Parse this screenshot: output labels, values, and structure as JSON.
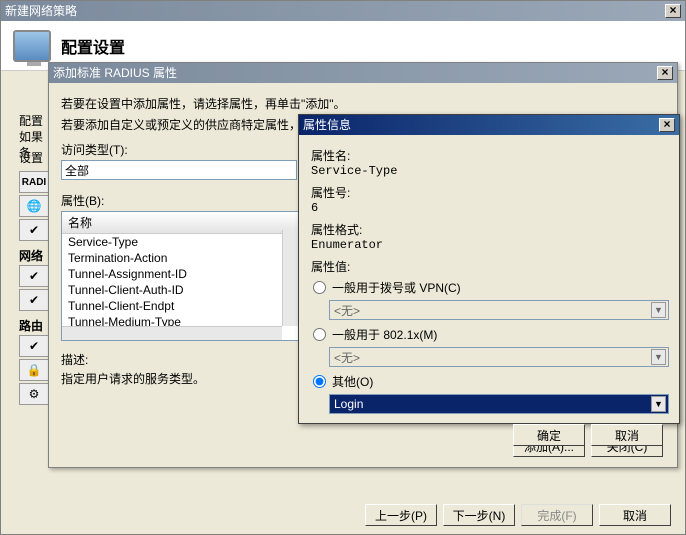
{
  "main": {
    "title": "新建网络策略",
    "header": "配置设置",
    "desc1": "配置",
    "desc2": "如果条",
    "settingsLabel": "设置",
    "radiLabel": "RADI",
    "sectionNet": "网络",
    "sectionRoute": "路由",
    "btnPrev": "上一步(P)",
    "btnNext": "下一步(N)",
    "btnFinish": "完成(F)",
    "btnCancel": "取消"
  },
  "radiusDlg": {
    "title": "添加标准 RADIUS 属性",
    "instr1": "若要在设置中添加属性，请选择属性，再单击\"添加\"。",
    "instr2": "若要添加自定义或预定义的供应商特定属性，",
    "accessLabel": "访问类型(T):",
    "accessValue": "全部",
    "attrLabel": "属性(B):",
    "listHeader": "名称",
    "items": [
      "Service-Type",
      "Termination-Action",
      "Tunnel-Assignment-ID",
      "Tunnel-Client-Auth-ID",
      "Tunnel-Client-Endpt",
      "Tunnel-Medium-Type"
    ],
    "descLabel": "描述:",
    "descText": "指定用户请求的服务类型。",
    "btnAdd": "添加(A)...",
    "btnClose": "关闭(C)"
  },
  "attrDlg": {
    "title": "属性信息",
    "nameLabel": "属性名:",
    "nameValue": "Service-Type",
    "numLabel": "属性号:",
    "numValue": "6",
    "formatLabel": "属性格式:",
    "formatValue": "Enumerator",
    "valueLabel": "属性值:",
    "opt1": "一般用于拨号或 VPN(C)",
    "opt1val": "<无>",
    "opt2": "一般用于 802.1x(M)",
    "opt2val": "<无>",
    "opt3": "其他(O)",
    "opt3val": "Login",
    "btnOk": "确定",
    "btnCancel": "取消"
  }
}
